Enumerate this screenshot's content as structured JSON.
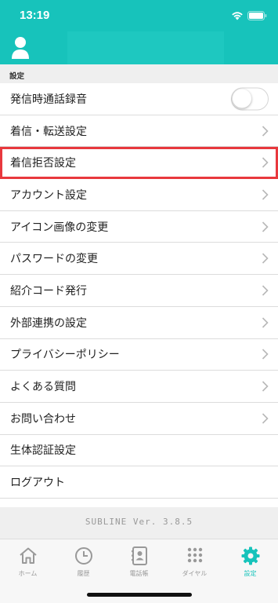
{
  "status": {
    "time": "13:19"
  },
  "section": {
    "title": "設定"
  },
  "menu": [
    {
      "label": "発信時通話録音",
      "type": "toggle",
      "on": false
    },
    {
      "label": "着信・転送設定",
      "type": "link"
    },
    {
      "label": "着信拒否設定",
      "type": "link",
      "highlighted": true
    },
    {
      "label": "アカウント設定",
      "type": "link"
    },
    {
      "label": "アイコン画像の変更",
      "type": "link"
    },
    {
      "label": "パスワードの変更",
      "type": "link"
    },
    {
      "label": "紹介コード発行",
      "type": "link"
    },
    {
      "label": "外部連携の設定",
      "type": "link"
    },
    {
      "label": "プライバシーポリシー",
      "type": "link"
    },
    {
      "label": "よくある質問",
      "type": "link"
    },
    {
      "label": "お問い合わせ",
      "type": "link"
    },
    {
      "label": "生体認証設定",
      "type": "plain"
    },
    {
      "label": "ログアウト",
      "type": "plain"
    }
  ],
  "version": "SUBLINE Ver. 3.8.5",
  "tabs": [
    {
      "label": "ホーム",
      "icon": "home-icon"
    },
    {
      "label": "履歴",
      "icon": "clock-icon"
    },
    {
      "label": "電話帳",
      "icon": "contacts-icon"
    },
    {
      "label": "ダイヤル",
      "icon": "dialpad-icon"
    },
    {
      "label": "設定",
      "icon": "gear-icon",
      "active": true
    }
  ],
  "colors": {
    "accent": "#17c3bb",
    "highlight": "#e8383d"
  }
}
